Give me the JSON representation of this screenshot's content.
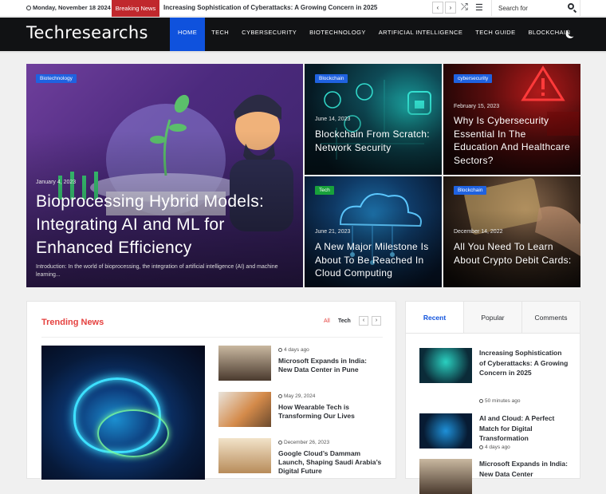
{
  "topbar": {
    "date": "Monday, November 18 2024",
    "breaking_label": "Breaking News",
    "ticker_text": "Increasing Sophistication of Cyberattacks: A Growing Concern in 2025",
    "prev_glyph": "‹",
    "next_glyph": "›",
    "shuffle_glyph": "⤮",
    "menu_glyph": "☰",
    "search_placeholder": "Search for"
  },
  "navbar": {
    "logo": "Techresearchs",
    "items": [
      "HOME",
      "TECH",
      "CYBERSECURITY",
      "BIOTECHNOLOGY",
      "ARTIFICIAL INTELLIGENCE",
      "TECH GUIDE",
      "BLOCKCHAIN"
    ],
    "active_index": 0
  },
  "featured": [
    {
      "tag": "Biotechnology",
      "date": "January 4, 2023",
      "title": "Bioprocessing Hybrid Models: Integrating AI and ML for Enhanced Efficiency",
      "excerpt": "Introduction: In the world of bioprocessing, the integration of artificial intelligence (AI) and machine learning..."
    },
    {
      "tag": "Blockchain",
      "date": "June 14, 2023",
      "title": "Blockchain From Scratch: Network Security"
    },
    {
      "tag": "cybersecurity",
      "date": "February 15, 2023",
      "title": "Why Is Cybersecurity Essential In The Education And Healthcare Sectors?"
    },
    {
      "tag": "Tech",
      "date": "June 21, 2023",
      "title": "A New Major Milestone Is About To Be Reached In Cloud Computing"
    },
    {
      "tag": "Blockchain",
      "date": "December 14, 2022",
      "title": "All You Need To Learn About Crypto Debit Cards:"
    }
  ],
  "trending": {
    "title": "Trending News",
    "filter_all": "All",
    "filter_tech": "Tech",
    "prev_glyph": "‹",
    "next_glyph": "›",
    "items": [
      {
        "meta": "4 days ago",
        "title": "Microsoft Expands in India: New Data Center in Pune"
      },
      {
        "meta": "May 29, 2024",
        "title": "How Wearable Tech is Transforming Our Lives"
      },
      {
        "meta": "December 26, 2023",
        "title": "Google Cloud’s Dammam Launch, Shaping Saudi Arabia’s Digital Future"
      }
    ]
  },
  "sidebar": {
    "tabs": [
      "Recent",
      "Popular",
      "Comments"
    ],
    "active_tab": 0,
    "items": [
      {
        "title": "Increasing Sophistication of Cyberattacks: A Growing Concern in 2025",
        "meta": "50 minutes ago"
      },
      {
        "title": "AI and Cloud: A Perfect Match for Digital Transformation",
        "meta": "4 days ago"
      },
      {
        "title": "Microsoft Expands in India: New Data Center"
      }
    ]
  },
  "colors": {
    "accent": "#0f52dd",
    "breaking": "#c0282d",
    "trending": "#e5413f",
    "tag_blue": "#1f62e0",
    "tag_green": "#18a13b",
    "nav_bg": "#111214"
  }
}
